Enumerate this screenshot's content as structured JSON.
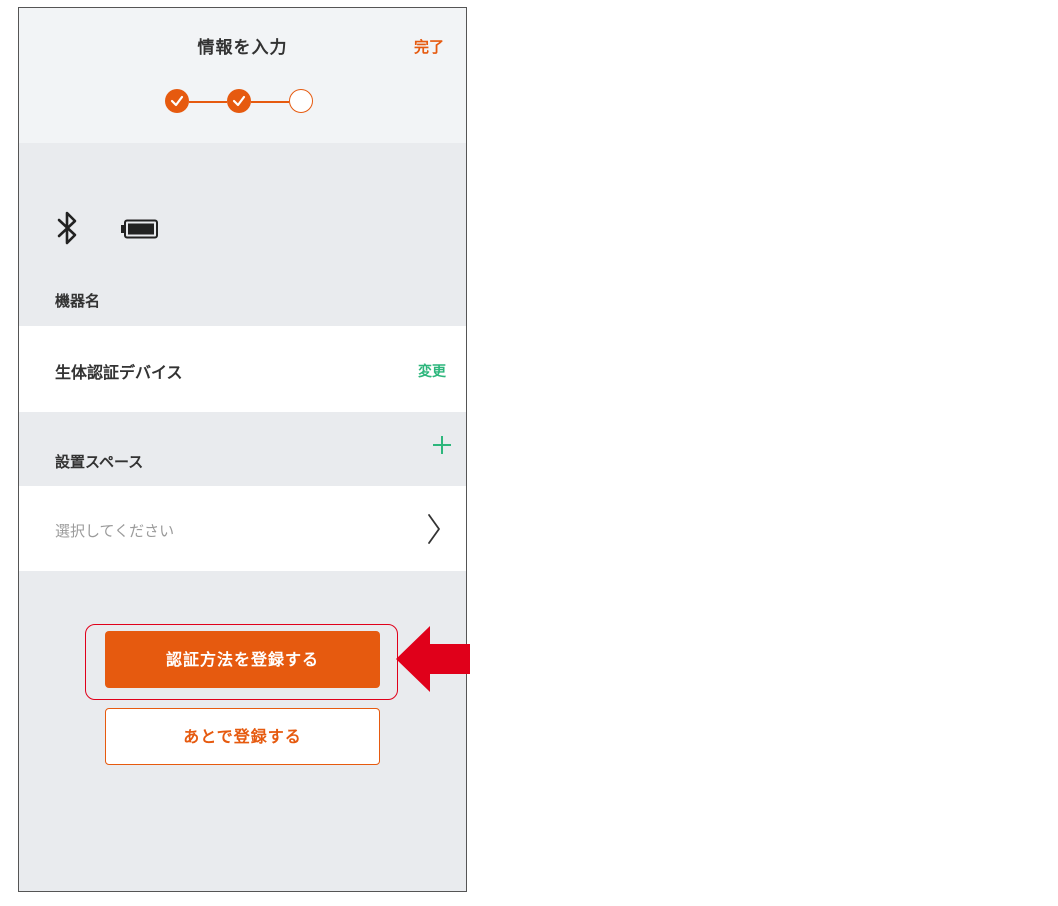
{
  "header": {
    "title": "情報を入力",
    "done_label": "完了"
  },
  "stepper": {
    "steps": [
      "completed",
      "completed",
      "current"
    ]
  },
  "status": {
    "icons": [
      "bluetooth-icon",
      "battery-icon"
    ]
  },
  "device_name": {
    "label": "機器名",
    "value": "生体認証デバイス",
    "change_label": "変更"
  },
  "install_space": {
    "label": "設置スペース",
    "placeholder": "選択してください",
    "add_icon": "plus-icon"
  },
  "actions": {
    "register_auth_label": "認証方法を登録する",
    "register_later_label": "あとで登録する"
  },
  "colors": {
    "accent": "#e65a0f",
    "green": "#2db67c",
    "highlight": "#e0001a",
    "arrow": "#e0001a"
  }
}
